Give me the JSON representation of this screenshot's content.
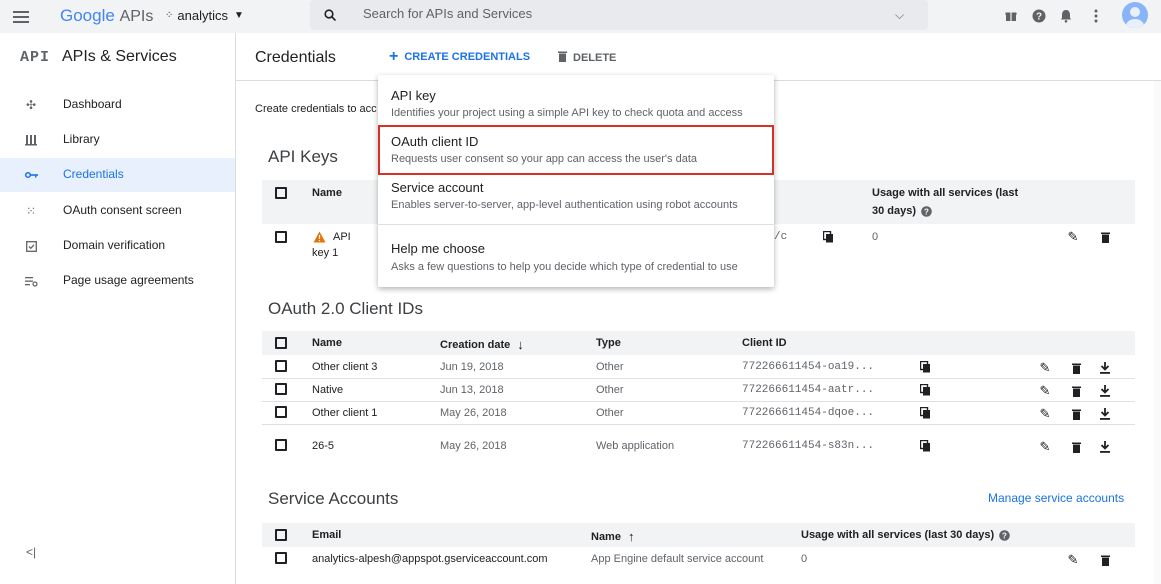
{
  "topbar": {
    "logo_google": "Google",
    "logo_apis": "APIs",
    "project": "analytics",
    "search_placeholder": "Search for APIs and Services"
  },
  "sidebar": {
    "api_badge": "API",
    "title": "APIs & Services",
    "items": [
      {
        "label": "Dashboard",
        "icon": "dashboard-icon"
      },
      {
        "label": "Library",
        "icon": "library-icon"
      },
      {
        "label": "Credentials",
        "icon": "key-icon"
      },
      {
        "label": "OAuth consent screen",
        "icon": "consent-icon"
      },
      {
        "label": "Domain verification",
        "icon": "checkbox-icon"
      },
      {
        "label": "Page usage agreements",
        "icon": "settings-list-icon"
      }
    ],
    "collapse": "<|"
  },
  "header": {
    "title": "Credentials",
    "create": "CREATE CREDENTIALS",
    "delete": "DELETE"
  },
  "intro": "Create credentials to acc",
  "api_keys": {
    "title": "API Keys",
    "col_name": "Name",
    "col_usage": "Usage with all services (last",
    "col_usage2": "30 days)",
    "row": {
      "name1": "API",
      "name2": "key 1",
      "key_tail": "/c",
      "usage": "0"
    }
  },
  "oauth": {
    "title": "OAuth 2.0 Client IDs",
    "cols": [
      "Name",
      "Creation date",
      "Type",
      "Client ID"
    ],
    "rows": [
      {
        "name": "Other client 3",
        "date": "Jun 19, 2018",
        "type": "Other",
        "id": "772266611454-oa19..."
      },
      {
        "name": "Native",
        "date": "Jun 13, 2018",
        "type": "Other",
        "id": "772266611454-aatr..."
      },
      {
        "name": "Other client 1",
        "date": "May 26, 2018",
        "type": "Other",
        "id": "772266611454-dqoe..."
      },
      {
        "name": "26-5",
        "date": "May 26, 2018",
        "type": "Web application",
        "id": "772266611454-s83n..."
      }
    ]
  },
  "service": {
    "title": "Service Accounts",
    "manage": "Manage service accounts",
    "cols": [
      "Email",
      "Name",
      "Usage with all services (last 30 days)"
    ],
    "row": {
      "email": "analytics-alpesh@appspot.gserviceaccount.com",
      "name": "App Engine default service account",
      "usage": "0"
    }
  },
  "menu": {
    "items": [
      {
        "title": "API key",
        "desc": "Identifies your project using a simple API key to check quota and access"
      },
      {
        "title": "OAuth client ID",
        "desc": "Requests user consent so your app can access the user's data"
      },
      {
        "title": "Service account",
        "desc": "Enables server-to-server, app-level authentication using robot accounts"
      },
      {
        "title": "Help me choose",
        "desc": "Asks a few questions to help you decide which type of credential to use"
      }
    ],
    "highlight_color": "#d93025"
  },
  "colors": {
    "accent": "#1a73e8",
    "warning": "#f9ab00"
  }
}
